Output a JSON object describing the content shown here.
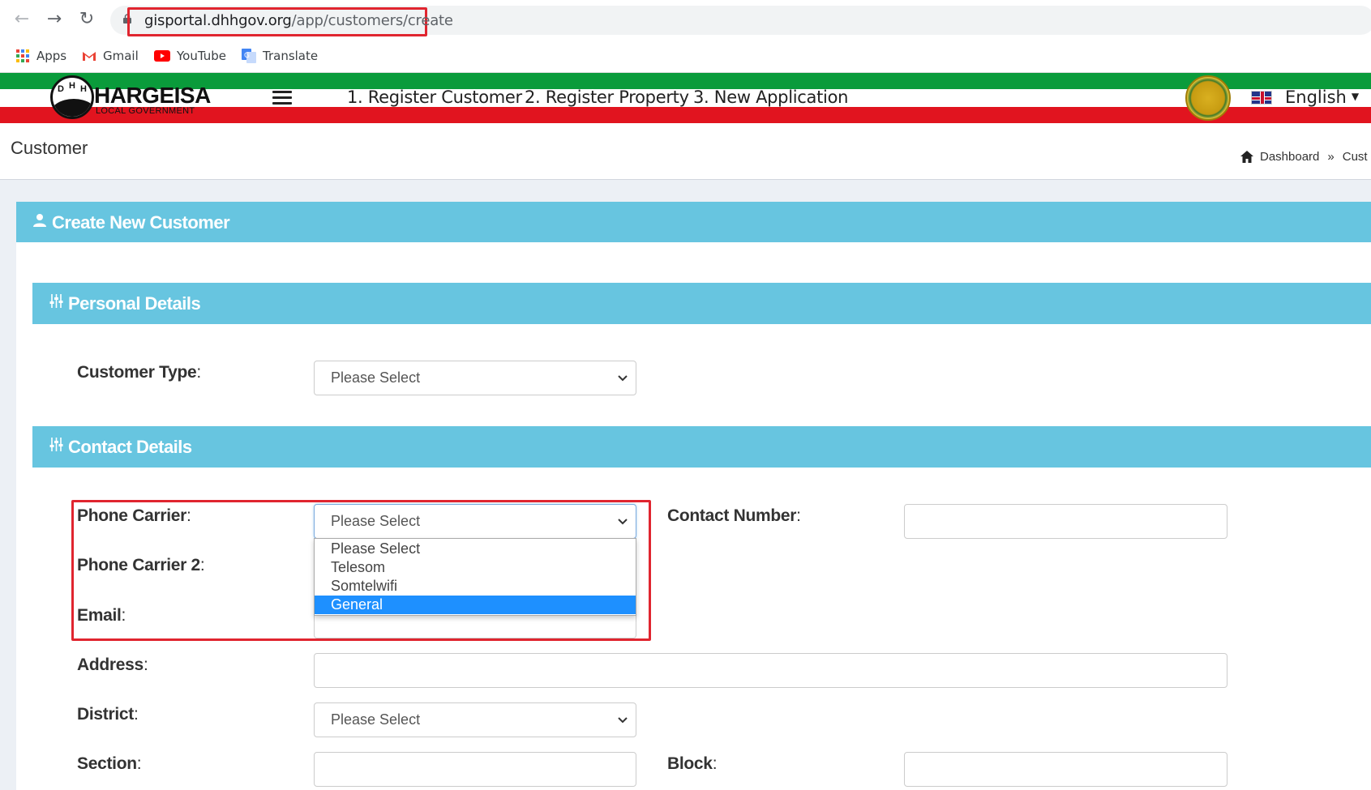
{
  "browser": {
    "url_host": "gisportal.dhhgov.org",
    "url_path": "/app/customers/create",
    "bookmarks": [
      {
        "label": "Apps",
        "icon": "apps-grid-icon"
      },
      {
        "label": "Gmail",
        "icon": "gmail-icon"
      },
      {
        "label": "YouTube",
        "icon": "youtube-icon"
      },
      {
        "label": "Translate",
        "icon": "translate-icon"
      }
    ]
  },
  "header": {
    "logo_name": "HARGEISA",
    "logo_sub": "LOCAL GOVERNMENT",
    "logo_letters": [
      "D",
      "H",
      "H"
    ],
    "nav": [
      "1. Register Customer",
      "2. Register Property",
      "3. New Application"
    ],
    "language": "English",
    "colors": {
      "green": "#0a9b3b",
      "red": "#e1141f",
      "accent": "#67c5e0"
    }
  },
  "content_header": {
    "title": "Customer",
    "breadcrumb": {
      "home": "Dashboard",
      "separator": "»",
      "current": "Cust"
    }
  },
  "box": {
    "title": "Create New Customer"
  },
  "personal": {
    "title": "Personal Details",
    "customer_type": {
      "label": "Customer Type",
      "value": "Please Select"
    }
  },
  "contact": {
    "title": "Contact Details",
    "phone_carrier": {
      "label": "Phone Carrier",
      "value": "Please Select"
    },
    "phone_carrier_2": {
      "label": "Phone Carrier 2"
    },
    "email": {
      "label": "Email"
    },
    "contact_number": {
      "label": "Contact Number",
      "value": ""
    },
    "address": {
      "label": "Address",
      "value": ""
    },
    "district": {
      "label": "District",
      "value": "Please Select"
    },
    "section": {
      "label": "Section",
      "value": ""
    },
    "block": {
      "label": "Block",
      "value": ""
    },
    "dropdown_options": [
      "Please Select",
      "Telesom",
      "Somtelwifi",
      "General"
    ],
    "dropdown_highlighted": "General"
  },
  "colon": ":"
}
